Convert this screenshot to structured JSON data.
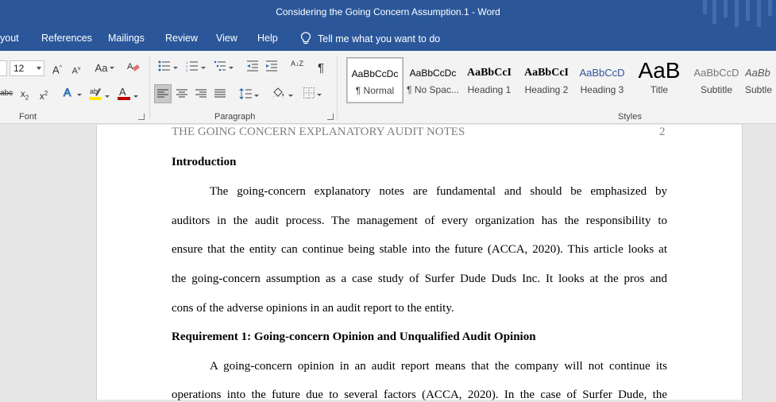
{
  "window": {
    "title": "Considering the Going Concern Assumption.1  -  Word"
  },
  "menu": {
    "items": [
      "yout",
      "References",
      "Mailings",
      "Review",
      "View",
      "Help"
    ],
    "tell_me": "Tell me what you want to do"
  },
  "ribbon": {
    "font": {
      "group_label": "Font",
      "size_value": "12",
      "grow_label": "A",
      "shrink_label": "A",
      "case_label": "Aa",
      "strike_label": "abc",
      "subscript_label": "x",
      "superscript_label": "x"
    },
    "paragraph": {
      "group_label": "Paragraph",
      "sort_label": "A↓Z",
      "pilcrow_label": "¶"
    },
    "styles": {
      "group_label": "Styles",
      "items": [
        {
          "preview": "AaBbCcDc",
          "name": "¶ Normal"
        },
        {
          "preview": "AaBbCcDc",
          "name": "¶ No Spac..."
        },
        {
          "preview": "AaBbCcI",
          "name": "Heading 1"
        },
        {
          "preview": "AaBbCcI",
          "name": "Heading 2"
        },
        {
          "preview": "AaBbCcD",
          "name": "Heading 3"
        },
        {
          "preview": "AaB",
          "name": "Title"
        },
        {
          "preview": "AaBbCcD",
          "name": "Subtitle"
        },
        {
          "preview": "AaBb",
          "name": "Subtle"
        }
      ]
    }
  },
  "document": {
    "running_head": "THE GOING CONCERN EXPLANATORY AUDIT NOTES",
    "page_number": "2",
    "heading_intro": "Introduction",
    "intro_lines": [
      "The going-concern explanatory notes are fundamental and should be emphasized by",
      "auditors in the audit process.  The management of every organization has the responsibility to",
      "ensure that the entity can continue being stable into the future (ACCA, 2020). This article looks at",
      "the going-concern assumption as a case study of Surfer Dude Duds Inc.  It looks at the pros and",
      "cons of the adverse opinions in an audit report to the entity."
    ],
    "heading_req1": "Requirement 1: Going-concern Opinion and Unqualified Audit Opinion",
    "req1_lines": [
      "A going-concern opinion in an audit report means that the company will not continue its",
      "operations into the future due to several factors (ACCA, 2020). In the case of Surfer Dude, the"
    ]
  }
}
